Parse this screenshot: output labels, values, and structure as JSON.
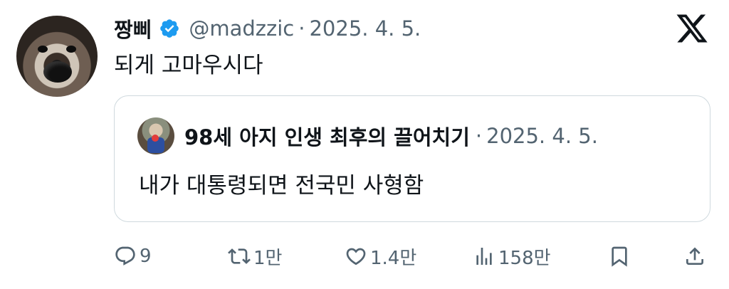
{
  "author": {
    "name": "짱삐",
    "handle": "@madzzic",
    "separator": "·",
    "date": "2025. 4. 5.",
    "verified": true
  },
  "tweet": {
    "text": "되게 고마우시다"
  },
  "quote": {
    "name": "98세 아지 인생 최후의 끌어치기",
    "separator": "·",
    "date": "2025. 4. 5.",
    "text": "내가 대통령되면 전국민 사형함"
  },
  "actions": {
    "replies": "9",
    "retweets": "1만",
    "likes": "1.4만",
    "views": "158만"
  },
  "colors": {
    "text": "#0f1419",
    "secondary": "#536471",
    "verified": "#1d9bf0",
    "border": "#cfd9de"
  },
  "icons": [
    "x-logo-icon",
    "verified-badge-icon",
    "reply-icon",
    "retweet-icon",
    "like-icon",
    "views-icon",
    "bookmark-icon",
    "share-icon"
  ]
}
